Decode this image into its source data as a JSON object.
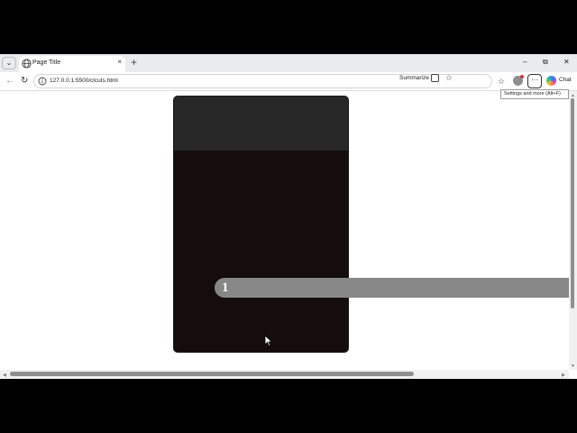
{
  "tab": {
    "title": "Page Title",
    "close": "×",
    "new_tab": "+",
    "menu": "⌄"
  },
  "window": {
    "minimize": "–",
    "restore": "⧉",
    "close": "✕"
  },
  "toolbar": {
    "back": "←",
    "reload": "↻",
    "url": "127.0.0.1:5500/clcuIs.html",
    "summarize": "Summarize",
    "favorite": "☆",
    "favorites_bar": "☆",
    "more": "···",
    "chat": "Chat"
  },
  "tooltip": "Settings and more (Alt+F)",
  "page": {
    "pill_number": "1"
  },
  "scroll": {
    "up": "▲",
    "down": "▼",
    "left": "◀",
    "right": "▶"
  },
  "colors": {
    "card_body": "#140d0b",
    "card_header": "#272727",
    "pill": "#878787"
  }
}
